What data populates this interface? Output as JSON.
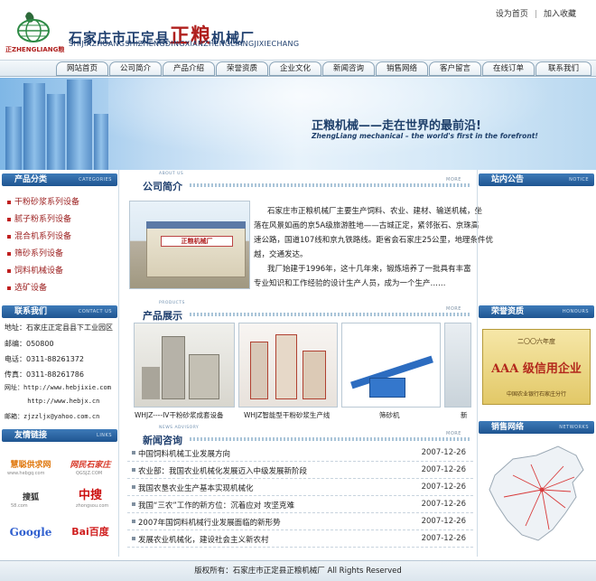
{
  "header": {
    "logo_caption": "正ZHENGLIANG粮",
    "brand_prefix": "石家庄市正定县",
    "brand_big": "正粮",
    "brand_suffix": "机械厂",
    "brand_en": "SHIJIAZHUANGSHIZHENGDINGXIANZHENGLIANGJIXIECHANG",
    "top_links": [
      "设为首页",
      "加入收藏"
    ]
  },
  "nav": [
    "网站首页",
    "公司简介",
    "产品介绍",
    "荣誉资质",
    "企业文化",
    "新闻咨询",
    "销售网络",
    "客户留言",
    "在线订单",
    "联系我们"
  ],
  "banner": {
    "slogan_cn": "正粮机械——走在世界的最前沿!",
    "slogan_en": "ZhengLiang mechanical – the world's first in the forefront!"
  },
  "left": {
    "categories_title": "产品分类",
    "categories_en": "CATEGORIES",
    "categories": [
      "干粉砂浆系列设备",
      "腻子粉系列设备",
      "混合机系列设备",
      "筛砂系列设备",
      "饲料机械设备",
      "选矿设备"
    ],
    "contact_title": "联系我们",
    "contact_en": "CONTACT US",
    "contact": [
      "地址：石家庄正定县县下工业园区",
      "邮编：050800",
      "电话：0311-88261372",
      "传真：0311-88261786",
      "网址：http://www.hebjixie.com",
      "      http://www.hebjx.cn",
      "邮箱：zjzzljx@yahoo.com.cn"
    ],
    "links_title": "友情链接",
    "links_en": "LINKS",
    "links": [
      "慧聪供求网",
      "网民石家庄",
      "搜狐",
      "中搜",
      "Google",
      "Bai百度"
    ],
    "link_sub": [
      "www.hebgq.com",
      "QGSJZ.COM",
      "58.com",
      "zhongsou.com",
      "",
      ""
    ]
  },
  "about": {
    "title": "公司简介",
    "title_en": "ABOUT US",
    "more": "MORE",
    "sign_text": "正粮机械厂",
    "lines": [
      "石家庄市正粮机械厂主要生产饲料、农业、建材、输送机械，坐",
      "落在风景如画的京5A级旅游胜地——古城正定，紧邻张石、京珠高",
      "速公路，国道107线和京九铁路线。距省会石家庄25公里，地理条件优",
      "越，交通发达。",
      "我厂始建于1996年，这十几年来，锻炼培养了一批具有丰富",
      "专业知识和工作经验的设计生产人员，成为一个生产……"
    ]
  },
  "products": {
    "title": "产品展示",
    "title_en": "PRODUCTS",
    "more": "MORE",
    "items": [
      "WHJZ----IV干粉砂浆成套设备",
      "WHJZ智能型干粉砂浆生产线",
      "筛砂机",
      "新"
    ]
  },
  "news": {
    "title": "新闻咨询",
    "title_en": "NEWS ADVISORY",
    "more": "MORE",
    "items": [
      {
        "title": "中国饲料机械工业发展方向",
        "date": "2007-12-26"
      },
      {
        "title": "农业部：我国农业机械化发展迈入中级发展新阶段",
        "date": "2007-12-26"
      },
      {
        "title": "我国农垦农业生产基本实现机械化",
        "date": "2007-12-26"
      },
      {
        "title": "我国“三农”工作的新方位：沉着应对 攻坚克难",
        "date": "2007-12-26"
      },
      {
        "title": "2007年国饲料机械行业发展面临的新形势",
        "date": "2007-12-26"
      },
      {
        "title": "发展农业机械化，建设社会主义新农村",
        "date": "2007-12-26"
      }
    ]
  },
  "right": {
    "notice_title": "站内公告",
    "notice_en": "NOTICE",
    "honor_title": "荣誉资质",
    "honor_en": "HONOURS",
    "cert_year": "二〇〇六年度",
    "cert_main": "AAA 级信用企业",
    "cert_issuer": "中国农业银行石家庄分行",
    "network_title": "销售网络",
    "network_en": "NETWORKS"
  },
  "footer": {
    "copyright": "版权所有：石家庄市正定县正粮机械厂  All Rights Reserved"
  }
}
